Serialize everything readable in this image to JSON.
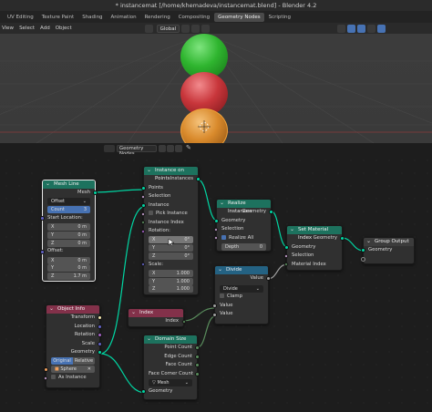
{
  "window": {
    "title": "* instancemat [/home/khemadeva/instancemat.blend] - Blender 4.2"
  },
  "tabs": [
    {
      "label": "UV Editing",
      "active": false
    },
    {
      "label": "Texture Paint",
      "active": false
    },
    {
      "label": "Shading",
      "active": false
    },
    {
      "label": "Animation",
      "active": false
    },
    {
      "label": "Rendering",
      "active": false
    },
    {
      "label": "Compositing",
      "active": false
    },
    {
      "label": "Geometry Nodes",
      "active": true
    },
    {
      "label": "Scripting",
      "active": false
    }
  ],
  "viewport_header": {
    "menus": [
      "View",
      "Select",
      "Add",
      "Object"
    ],
    "orientation": "Global"
  },
  "node_editor_header": {
    "tree_name": "Geometry Nodes"
  },
  "nodes": {
    "mesh_line": {
      "title": "Mesh Line",
      "output": "Mesh",
      "mode": "Offset",
      "count_label": "Count",
      "count_value": "3",
      "start_label": "Start Location:",
      "start": [
        {
          "axis": "X",
          "value": "0 m"
        },
        {
          "axis": "Y",
          "value": "0 m"
        },
        {
          "axis": "Z",
          "value": "0 m"
        }
      ],
      "offset_label": "Offset:",
      "offset": [
        {
          "axis": "X",
          "value": "0 m"
        },
        {
          "axis": "Y",
          "value": "0 m"
        },
        {
          "axis": "Z",
          "value": "1.7 m"
        }
      ]
    },
    "instance_on_points": {
      "title": "Instance on Points",
      "output": "Instances",
      "points": "Points",
      "selection": "Selection",
      "instance": "Instance",
      "pick_instance": "Pick Instance",
      "instance_index": "Instance Index",
      "rotation_label": "Rotation:",
      "rotation": [
        {
          "axis": "X",
          "value": "0°"
        },
        {
          "axis": "Y",
          "value": "0°"
        },
        {
          "axis": "Z",
          "value": "0°"
        }
      ],
      "scale_label": "Scale:",
      "scale": [
        {
          "axis": "X",
          "value": "1.000"
        },
        {
          "axis": "Y",
          "value": "1.000"
        },
        {
          "axis": "Z",
          "value": "1.000"
        }
      ]
    },
    "realize_instances": {
      "title": "Realize Instances",
      "output": "Geometry",
      "geometry": "Geometry",
      "selection": "Selection",
      "realize_all": "Realize All",
      "depth_label": "Depth",
      "depth_value": "0"
    },
    "set_material_index": {
      "title": "Set Material Index",
      "output": "Geometry",
      "geometry": "Geometry",
      "selection": "Selection",
      "material_index": "Material Index"
    },
    "group_output": {
      "title": "Group Output",
      "geometry": "Geometry"
    },
    "divide": {
      "title": "Divide",
      "output": "Value",
      "operation": "Divide",
      "clamp": "Clamp",
      "value1": "Value",
      "value2": "Value"
    },
    "index": {
      "title": "Index",
      "output": "Index"
    },
    "object_info": {
      "title": "Object Info",
      "outputs": [
        "Transform",
        "Location",
        "Rotation",
        "Scale",
        "Geometry"
      ],
      "mode_original": "Original",
      "mode_relative": "Relative",
      "object": "Sphere",
      "as_instance": "As Instance"
    },
    "domain_size": {
      "title": "Domain Size",
      "outputs": [
        "Point Count",
        "Edge Count",
        "Face Count",
        "Face Corner Count"
      ],
      "component": "Mesh",
      "geometry": "Geometry"
    }
  },
  "colors": {
    "geometry_header": "#1d725e",
    "input_header": "#83314a",
    "converter_header": "#246283",
    "output_header": "#3c3c3c",
    "sphere_top": "#2fb52f",
    "sphere_mid": "#c8363b",
    "sphere_bottom": "#d98a2c"
  }
}
